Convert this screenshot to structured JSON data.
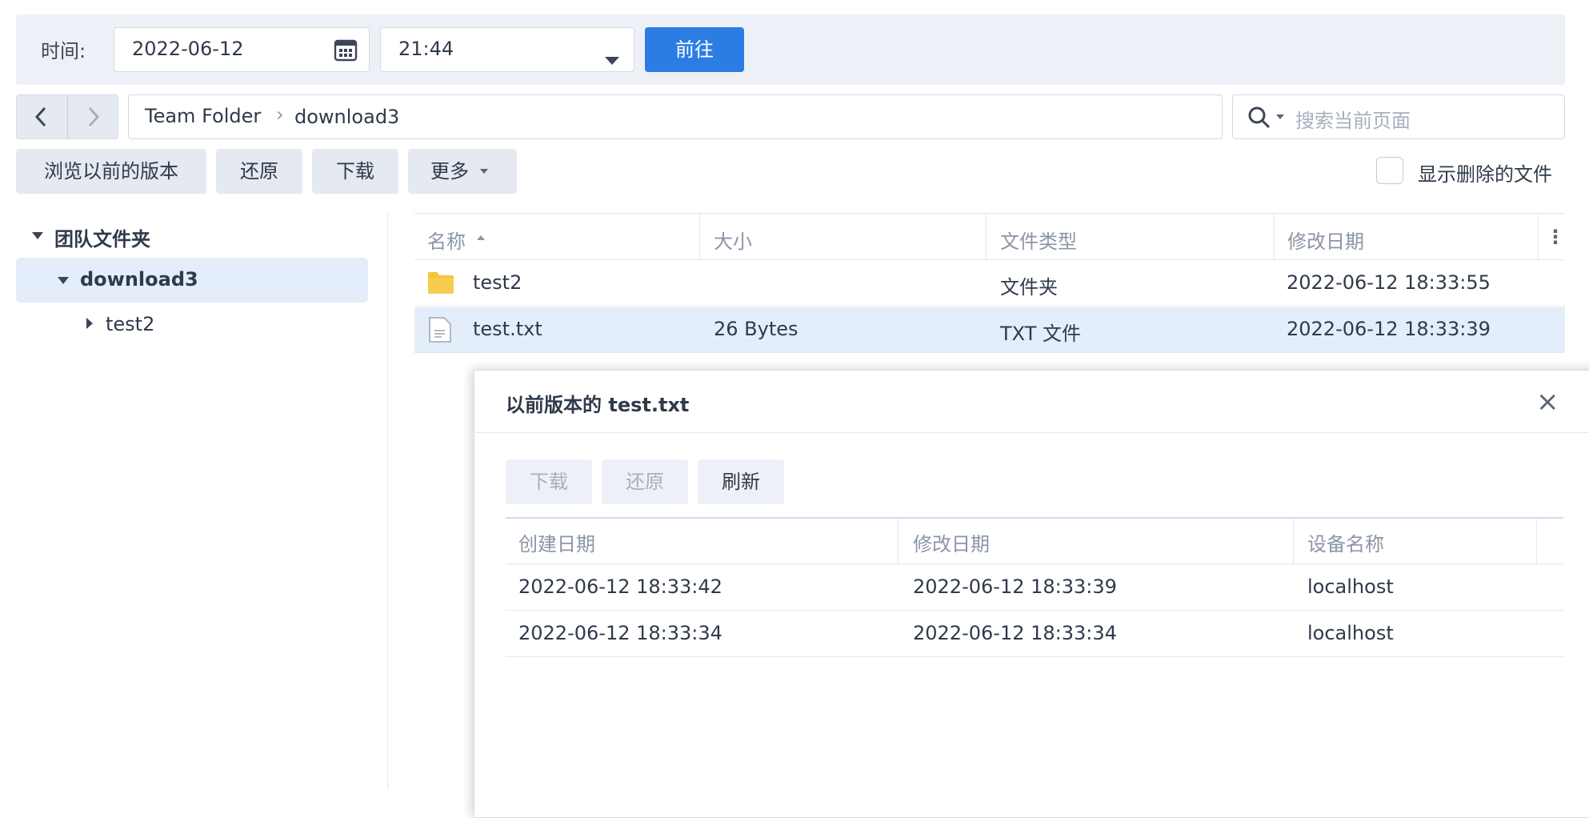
{
  "timebar": {
    "label": "时间:",
    "date_value": "2022-06-12",
    "time_value": "21:44",
    "go_label": "前往"
  },
  "nav": {
    "path_root": "Team Folder",
    "path_separator": "›",
    "path_current": "download3",
    "search_placeholder": "搜索当前页面"
  },
  "toolbar": {
    "browse_versions_label": "浏览以前的版本",
    "restore_label": "还原",
    "download_label": "下载",
    "more_label": "更多",
    "show_deleted_label": "显示删除的文件"
  },
  "tree": {
    "root_label": "团队文件夹",
    "folder_label": "download3",
    "child_label": "test2"
  },
  "files": {
    "columns": [
      "名称",
      "大小",
      "文件类型",
      "修改日期"
    ],
    "rows": [
      {
        "name": "test2",
        "size": "",
        "type": "文件夹",
        "modified": "2022-06-12 18:33:55",
        "icon": "folder-icon"
      },
      {
        "name": "test.txt",
        "size": "26 Bytes",
        "type": "TXT 文件",
        "modified": "2022-06-12 18:33:39",
        "icon": "text-file-icon"
      }
    ]
  },
  "dialog": {
    "title": "以前版本的 test.txt",
    "download_label": "下载",
    "restore_label": "还原",
    "refresh_label": "刷新",
    "columns": [
      "创建日期",
      "修改日期",
      "设备名称"
    ],
    "rows": [
      {
        "created": "2022-06-12 18:33:42",
        "modified": "2022-06-12 18:33:39",
        "device": "localhost"
      },
      {
        "created": "2022-06-12 18:33:34",
        "modified": "2022-06-12 18:33:34",
        "device": "localhost"
      }
    ]
  },
  "colors": {
    "accent": "#2b7de3",
    "selection": "#e4eefa",
    "folder": "#f5c33b"
  }
}
